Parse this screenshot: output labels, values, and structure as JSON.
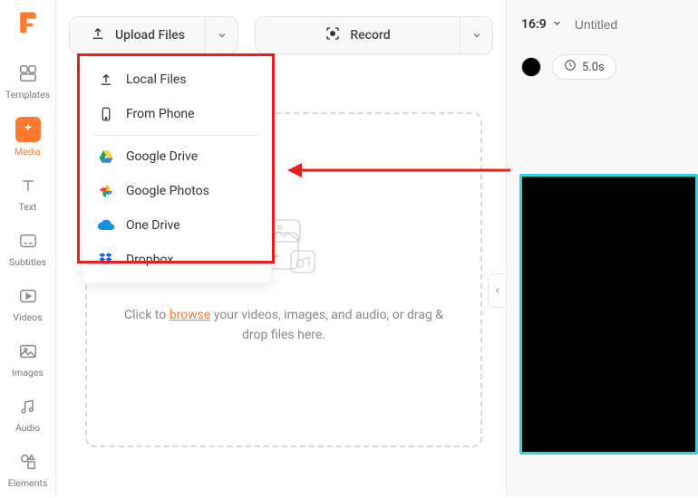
{
  "sidebar": {
    "items": [
      {
        "label": "Templates"
      },
      {
        "label": "Media"
      },
      {
        "label": "Text"
      },
      {
        "label": "Subtitles"
      },
      {
        "label": "Videos"
      },
      {
        "label": "Images"
      },
      {
        "label": "Audio"
      },
      {
        "label": "Elements"
      }
    ]
  },
  "toolbar": {
    "upload_label": "Upload Files",
    "record_label": "Record"
  },
  "upload_menu": {
    "local": "Local Files",
    "phone": "From Phone",
    "gdrive": "Google Drive",
    "gphotos": "Google Photos",
    "onedrive": "One Drive",
    "dropbox": "Dropbox"
  },
  "dropzone": {
    "prefix": "Click to ",
    "link": "browse",
    "suffix": " your videos, images, and audio, or drag & drop files here."
  },
  "right": {
    "aspect": "16:9",
    "title_placeholder": "Untitled",
    "duration": "5.0s"
  },
  "colors": {
    "accent": "#ff7a2f",
    "annotation": "#e52020",
    "preview_border": "#27d9e6"
  }
}
